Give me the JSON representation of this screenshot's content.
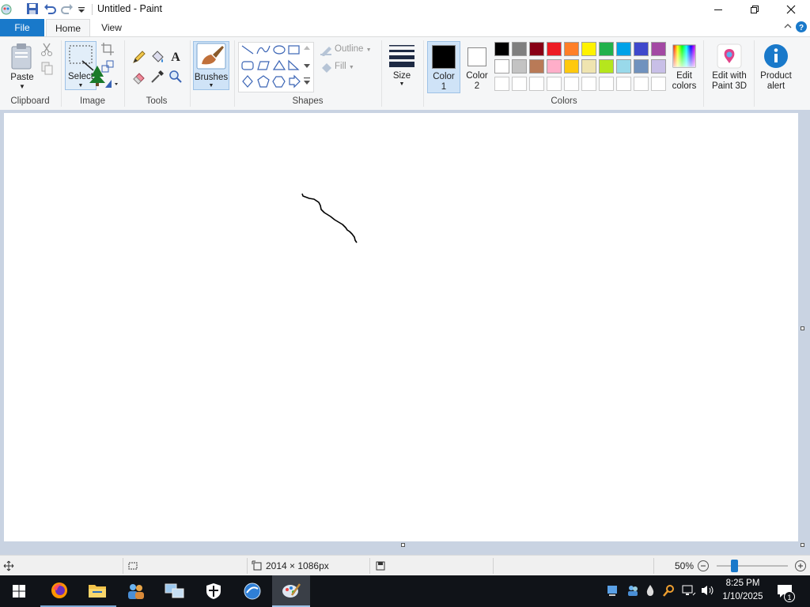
{
  "window": {
    "title": "Untitled - Paint"
  },
  "tabs": {
    "file": "File",
    "home": "Home",
    "view": "View"
  },
  "ribbon": {
    "clipboard": {
      "paste": "Paste",
      "group": "Clipboard"
    },
    "image": {
      "select": "Select",
      "group": "Image"
    },
    "tools": {
      "group": "Tools"
    },
    "brushes": {
      "label": "Brushes"
    },
    "shapes": {
      "outline": "Outline",
      "fill": "Fill",
      "group": "Shapes"
    },
    "size": {
      "label": "Size"
    },
    "colors": {
      "color1_line1": "Color",
      "color1_line2": "1",
      "color2_line1": "Color",
      "color2_line2": "2",
      "group": "Colors",
      "edit_line1": "Edit",
      "edit_line2": "colors",
      "palette_row1": [
        "#000000",
        "#7f7f7f",
        "#880015",
        "#ed1c24",
        "#ff7f27",
        "#fff200",
        "#22b14c",
        "#00a2e8",
        "#3f48cc",
        "#a349a4"
      ],
      "palette_row2": [
        "#ffffff",
        "#c3c3c3",
        "#b97a57",
        "#ffaec9",
        "#ffc90e",
        "#efe4b0",
        "#b5e61d",
        "#99d9ea",
        "#7092be",
        "#c8bfe7"
      ],
      "palette_row3": [
        "#ffffff",
        "#ffffff",
        "#ffffff",
        "#ffffff",
        "#ffffff",
        "#ffffff",
        "#ffffff",
        "#ffffff",
        "#ffffff",
        "#ffffff"
      ],
      "primary": "#000000",
      "secondary": "#ffffff"
    },
    "paint3d": {
      "line1": "Edit with",
      "line2": "Paint 3D"
    },
    "alert": {
      "line1": "Product",
      "line2": "alert"
    }
  },
  "status": {
    "dimensions": "2014 × 1086px",
    "zoom": "50%",
    "zoom_fraction": 0.25
  },
  "taskbar": {
    "time": "8:25 PM",
    "date": "1/10/2025",
    "notifications": "1"
  }
}
